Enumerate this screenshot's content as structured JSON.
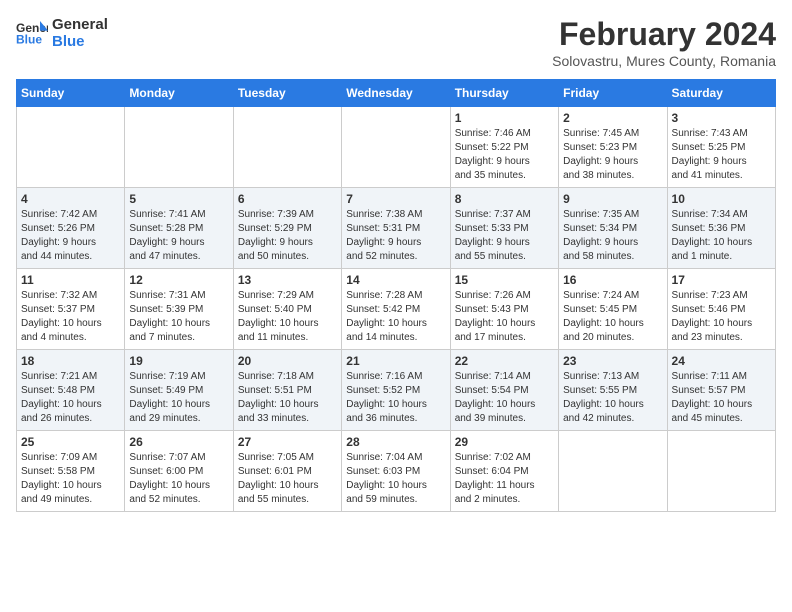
{
  "header": {
    "logo_line1": "General",
    "logo_line2": "Blue",
    "month_year": "February 2024",
    "location": "Solovastru, Mures County, Romania"
  },
  "weekdays": [
    "Sunday",
    "Monday",
    "Tuesday",
    "Wednesday",
    "Thursday",
    "Friday",
    "Saturday"
  ],
  "weeks": [
    [
      {
        "day": "",
        "info": ""
      },
      {
        "day": "",
        "info": ""
      },
      {
        "day": "",
        "info": ""
      },
      {
        "day": "",
        "info": ""
      },
      {
        "day": "1",
        "info": "Sunrise: 7:46 AM\nSunset: 5:22 PM\nDaylight: 9 hours\nand 35 minutes."
      },
      {
        "day": "2",
        "info": "Sunrise: 7:45 AM\nSunset: 5:23 PM\nDaylight: 9 hours\nand 38 minutes."
      },
      {
        "day": "3",
        "info": "Sunrise: 7:43 AM\nSunset: 5:25 PM\nDaylight: 9 hours\nand 41 minutes."
      }
    ],
    [
      {
        "day": "4",
        "info": "Sunrise: 7:42 AM\nSunset: 5:26 PM\nDaylight: 9 hours\nand 44 minutes."
      },
      {
        "day": "5",
        "info": "Sunrise: 7:41 AM\nSunset: 5:28 PM\nDaylight: 9 hours\nand 47 minutes."
      },
      {
        "day": "6",
        "info": "Sunrise: 7:39 AM\nSunset: 5:29 PM\nDaylight: 9 hours\nand 50 minutes."
      },
      {
        "day": "7",
        "info": "Sunrise: 7:38 AM\nSunset: 5:31 PM\nDaylight: 9 hours\nand 52 minutes."
      },
      {
        "day": "8",
        "info": "Sunrise: 7:37 AM\nSunset: 5:33 PM\nDaylight: 9 hours\nand 55 minutes."
      },
      {
        "day": "9",
        "info": "Sunrise: 7:35 AM\nSunset: 5:34 PM\nDaylight: 9 hours\nand 58 minutes."
      },
      {
        "day": "10",
        "info": "Sunrise: 7:34 AM\nSunset: 5:36 PM\nDaylight: 10 hours\nand 1 minute."
      }
    ],
    [
      {
        "day": "11",
        "info": "Sunrise: 7:32 AM\nSunset: 5:37 PM\nDaylight: 10 hours\nand 4 minutes."
      },
      {
        "day": "12",
        "info": "Sunrise: 7:31 AM\nSunset: 5:39 PM\nDaylight: 10 hours\nand 7 minutes."
      },
      {
        "day": "13",
        "info": "Sunrise: 7:29 AM\nSunset: 5:40 PM\nDaylight: 10 hours\nand 11 minutes."
      },
      {
        "day": "14",
        "info": "Sunrise: 7:28 AM\nSunset: 5:42 PM\nDaylight: 10 hours\nand 14 minutes."
      },
      {
        "day": "15",
        "info": "Sunrise: 7:26 AM\nSunset: 5:43 PM\nDaylight: 10 hours\nand 17 minutes."
      },
      {
        "day": "16",
        "info": "Sunrise: 7:24 AM\nSunset: 5:45 PM\nDaylight: 10 hours\nand 20 minutes."
      },
      {
        "day": "17",
        "info": "Sunrise: 7:23 AM\nSunset: 5:46 PM\nDaylight: 10 hours\nand 23 minutes."
      }
    ],
    [
      {
        "day": "18",
        "info": "Sunrise: 7:21 AM\nSunset: 5:48 PM\nDaylight: 10 hours\nand 26 minutes."
      },
      {
        "day": "19",
        "info": "Sunrise: 7:19 AM\nSunset: 5:49 PM\nDaylight: 10 hours\nand 29 minutes."
      },
      {
        "day": "20",
        "info": "Sunrise: 7:18 AM\nSunset: 5:51 PM\nDaylight: 10 hours\nand 33 minutes."
      },
      {
        "day": "21",
        "info": "Sunrise: 7:16 AM\nSunset: 5:52 PM\nDaylight: 10 hours\nand 36 minutes."
      },
      {
        "day": "22",
        "info": "Sunrise: 7:14 AM\nSunset: 5:54 PM\nDaylight: 10 hours\nand 39 minutes."
      },
      {
        "day": "23",
        "info": "Sunrise: 7:13 AM\nSunset: 5:55 PM\nDaylight: 10 hours\nand 42 minutes."
      },
      {
        "day": "24",
        "info": "Sunrise: 7:11 AM\nSunset: 5:57 PM\nDaylight: 10 hours\nand 45 minutes."
      }
    ],
    [
      {
        "day": "25",
        "info": "Sunrise: 7:09 AM\nSunset: 5:58 PM\nDaylight: 10 hours\nand 49 minutes."
      },
      {
        "day": "26",
        "info": "Sunrise: 7:07 AM\nSunset: 6:00 PM\nDaylight: 10 hours\nand 52 minutes."
      },
      {
        "day": "27",
        "info": "Sunrise: 7:05 AM\nSunset: 6:01 PM\nDaylight: 10 hours\nand 55 minutes."
      },
      {
        "day": "28",
        "info": "Sunrise: 7:04 AM\nSunset: 6:03 PM\nDaylight: 10 hours\nand 59 minutes."
      },
      {
        "day": "29",
        "info": "Sunrise: 7:02 AM\nSunset: 6:04 PM\nDaylight: 11 hours\nand 2 minutes."
      },
      {
        "day": "",
        "info": ""
      },
      {
        "day": "",
        "info": ""
      }
    ]
  ]
}
